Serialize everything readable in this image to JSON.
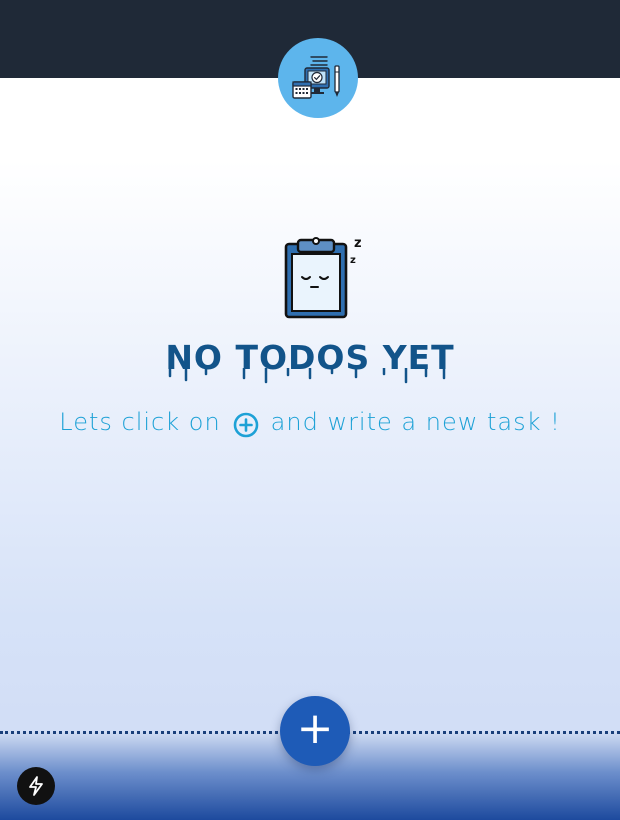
{
  "empty_state": {
    "title": "NO TODOS YET",
    "hint_before": "Lets click on",
    "hint_after": "and write a new task !"
  },
  "icons": {
    "header_logo": "task-board-icon",
    "empty_illustration": "sleeping-clipboard-icon",
    "inline_add": "plus-circle-icon",
    "fab": "plus-icon",
    "corner": "lightning-bolt-icon"
  },
  "fab": {
    "label": "+"
  },
  "colors": {
    "topbar": "#1f2937",
    "logo_bg": "#5db5ec",
    "title": "#12548a",
    "hint": "#1da1d6",
    "fab": "#1e5bb7",
    "bottom_band": "#1d4a9e"
  }
}
